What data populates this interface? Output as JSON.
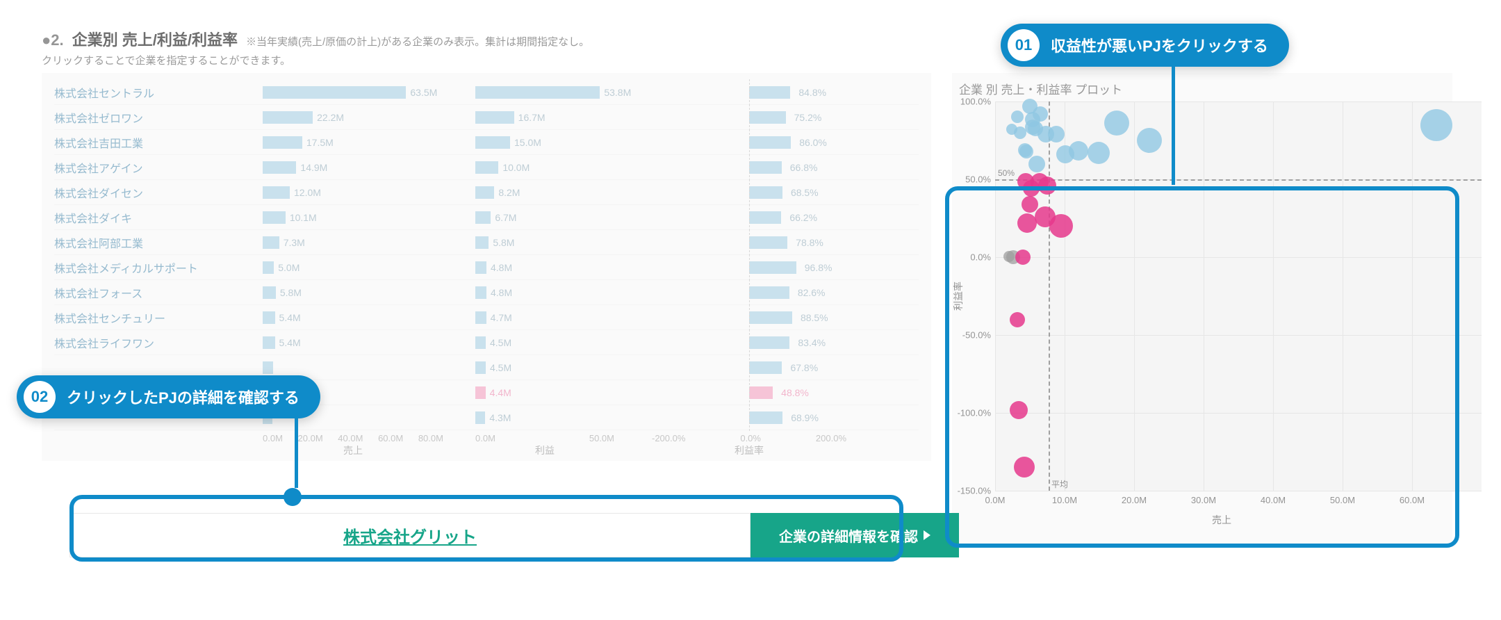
{
  "section": {
    "number": "●2.",
    "title": "企業別 売上/利益/利益率",
    "note": "※当年実績(売上/原価の計上)がある企業のみ表示。集計は期間指定なし。",
    "sub": "クリックすることで企業を指定することができます。"
  },
  "annotations": [
    {
      "num": "01",
      "text": "収益性が悪いPJをクリックする"
    },
    {
      "num": "02",
      "text": "クリックしたPJの詳細を確認する"
    }
  ],
  "detail": {
    "company": "株式会社グリット",
    "button": "企業の詳細情報を確認"
  },
  "scatter_title": "企業 別 売上・利益率 プロット",
  "scatter_ylab": "利益率",
  "scatter_xlab": "売上",
  "scatter_ref_50": "50%",
  "scatter_ref_avg": "平均",
  "chart_data": {
    "bars": {
      "type": "bar",
      "companies": [
        "株式会社セントラル",
        "株式会社ゼロワン",
        "株式会社吉田工業",
        "株式会社アゲイン",
        "株式会社ダイセン",
        "株式会社ダイキ",
        "株式会社阿部工業",
        "株式会社メディカルサポート",
        "株式会社フォース",
        "株式会社センチュリー",
        "株式会社ライフワン",
        "",
        "",
        ""
      ],
      "sales": {
        "label": "売上",
        "values": [
          "63.5M",
          "22.2M",
          "17.5M",
          "14.9M",
          "12.0M",
          "10.1M",
          "7.3M",
          "5.0M",
          "5.8M",
          "5.4M",
          "5.4M",
          "",
          "",
          ""
        ],
        "nums": [
          63.5,
          22.2,
          17.5,
          14.9,
          12.0,
          10.1,
          7.3,
          5.0,
          5.8,
          5.4,
          5.4,
          4.5,
          4.4,
          4.3
        ],
        "ticks": [
          "0.0M",
          "20.0M",
          "40.0M",
          "60.0M",
          "80.0M"
        ],
        "max": 80
      },
      "profit": {
        "label": "利益",
        "values": [
          "53.8M",
          "16.7M",
          "15.0M",
          "10.0M",
          "8.2M",
          "6.7M",
          "5.8M",
          "4.8M",
          "4.8M",
          "4.7M",
          "4.5M",
          "4.5M",
          "4.4M",
          "4.3M"
        ],
        "nums": [
          53.8,
          16.7,
          15.0,
          10.0,
          8.2,
          6.7,
          5.8,
          4.8,
          4.8,
          4.7,
          4.5,
          4.5,
          4.4,
          4.3
        ],
        "ticks": [
          "0.0M",
          "50.0M"
        ],
        "max": 60,
        "pink_idx": [
          12
        ]
      },
      "margin": {
        "label": "利益率",
        "values": [
          "84.8%",
          "75.2%",
          "86.0%",
          "66.8%",
          "68.5%",
          "66.2%",
          "78.8%",
          "96.8%",
          "82.6%",
          "88.5%",
          "83.4%",
          "67.8%",
          "48.8%",
          "68.9%"
        ],
        "nums": [
          84.8,
          75.2,
          86.0,
          66.8,
          68.5,
          66.2,
          78.8,
          96.8,
          82.6,
          88.5,
          83.4,
          67.8,
          48.8,
          68.9
        ],
        "ticks": [
          "-200.0%",
          "0.0%",
          "200.0%"
        ],
        "range": [
          -200,
          200
        ],
        "pink_idx": [
          12
        ]
      }
    },
    "scatter": {
      "type": "scatter",
      "xlabel": "売上",
      "ylabel": "利益率",
      "xlim": [
        0,
        70
      ],
      "ylim": [
        -150,
        100
      ],
      "xticks": [
        "0.0M",
        "10.0M",
        "20.0M",
        "30.0M",
        "40.0M",
        "50.0M",
        "60.0M"
      ],
      "yticks": [
        "100.0%",
        "50.0%",
        "0.0%",
        "-50.0%",
        "-100.0%",
        "-150.0%"
      ],
      "ref_y": 50,
      "ref_x": 7.7,
      "ref_x_label": "平均",
      "points": [
        {
          "x": 63.5,
          "y": 84.8,
          "r": 23,
          "c": "blue"
        },
        {
          "x": 22.2,
          "y": 75.2,
          "r": 18,
          "c": "blue"
        },
        {
          "x": 17.5,
          "y": 86.0,
          "r": 18,
          "c": "blue"
        },
        {
          "x": 14.9,
          "y": 66.8,
          "r": 16,
          "c": "blue"
        },
        {
          "x": 12.0,
          "y": 68.5,
          "r": 14,
          "c": "blue"
        },
        {
          "x": 10.1,
          "y": 66.2,
          "r": 13,
          "c": "blue"
        },
        {
          "x": 7.3,
          "y": 78.8,
          "r": 12,
          "c": "blue"
        },
        {
          "x": 5.0,
          "y": 96.8,
          "r": 11,
          "c": "blue"
        },
        {
          "x": 5.8,
          "y": 82.6,
          "r": 11,
          "c": "blue"
        },
        {
          "x": 5.4,
          "y": 88.5,
          "r": 11,
          "c": "blue"
        },
        {
          "x": 5.4,
          "y": 83.4,
          "r": 11,
          "c": "blue"
        },
        {
          "x": 4.5,
          "y": 67.8,
          "r": 10,
          "c": "blue"
        },
        {
          "x": 4.3,
          "y": 68.9,
          "r": 10,
          "c": "blue"
        },
        {
          "x": 3.2,
          "y": 90.0,
          "r": 9,
          "c": "blue"
        },
        {
          "x": 3.6,
          "y": 80.0,
          "r": 9,
          "c": "blue"
        },
        {
          "x": 2.4,
          "y": 82.0,
          "r": 8,
          "c": "blue"
        },
        {
          "x": 6.5,
          "y": 92.0,
          "r": 11,
          "c": "blue"
        },
        {
          "x": 8.8,
          "y": 79.0,
          "r": 12,
          "c": "blue"
        },
        {
          "x": 6.0,
          "y": 60.0,
          "r": 12,
          "c": "blue"
        },
        {
          "x": 2.6,
          "y": 0.0,
          "r": 10,
          "c": "grey"
        },
        {
          "x": 2.0,
          "y": 0.5,
          "r": 8,
          "c": "grey"
        },
        {
          "x": 4.4,
          "y": 48.8,
          "r": 12,
          "c": "pink"
        },
        {
          "x": 5.2,
          "y": 44.0,
          "r": 12,
          "c": "pink"
        },
        {
          "x": 6.4,
          "y": 48.0,
          "r": 13,
          "c": "pink"
        },
        {
          "x": 7.5,
          "y": 46.0,
          "r": 13,
          "c": "pink"
        },
        {
          "x": 5.0,
          "y": 34.0,
          "r": 12,
          "c": "pink"
        },
        {
          "x": 4.6,
          "y": 22.0,
          "r": 14,
          "c": "pink"
        },
        {
          "x": 7.2,
          "y": 26.0,
          "r": 15,
          "c": "pink"
        },
        {
          "x": 9.5,
          "y": 20.0,
          "r": 17,
          "c": "pink"
        },
        {
          "x": 4.0,
          "y": 0.0,
          "r": 11,
          "c": "pink"
        },
        {
          "x": 3.2,
          "y": -40.0,
          "r": 11,
          "c": "pink"
        },
        {
          "x": 3.4,
          "y": -98.0,
          "r": 13,
          "c": "pink"
        },
        {
          "x": 4.2,
          "y": -135.0,
          "r": 15,
          "c": "pink"
        }
      ]
    }
  }
}
